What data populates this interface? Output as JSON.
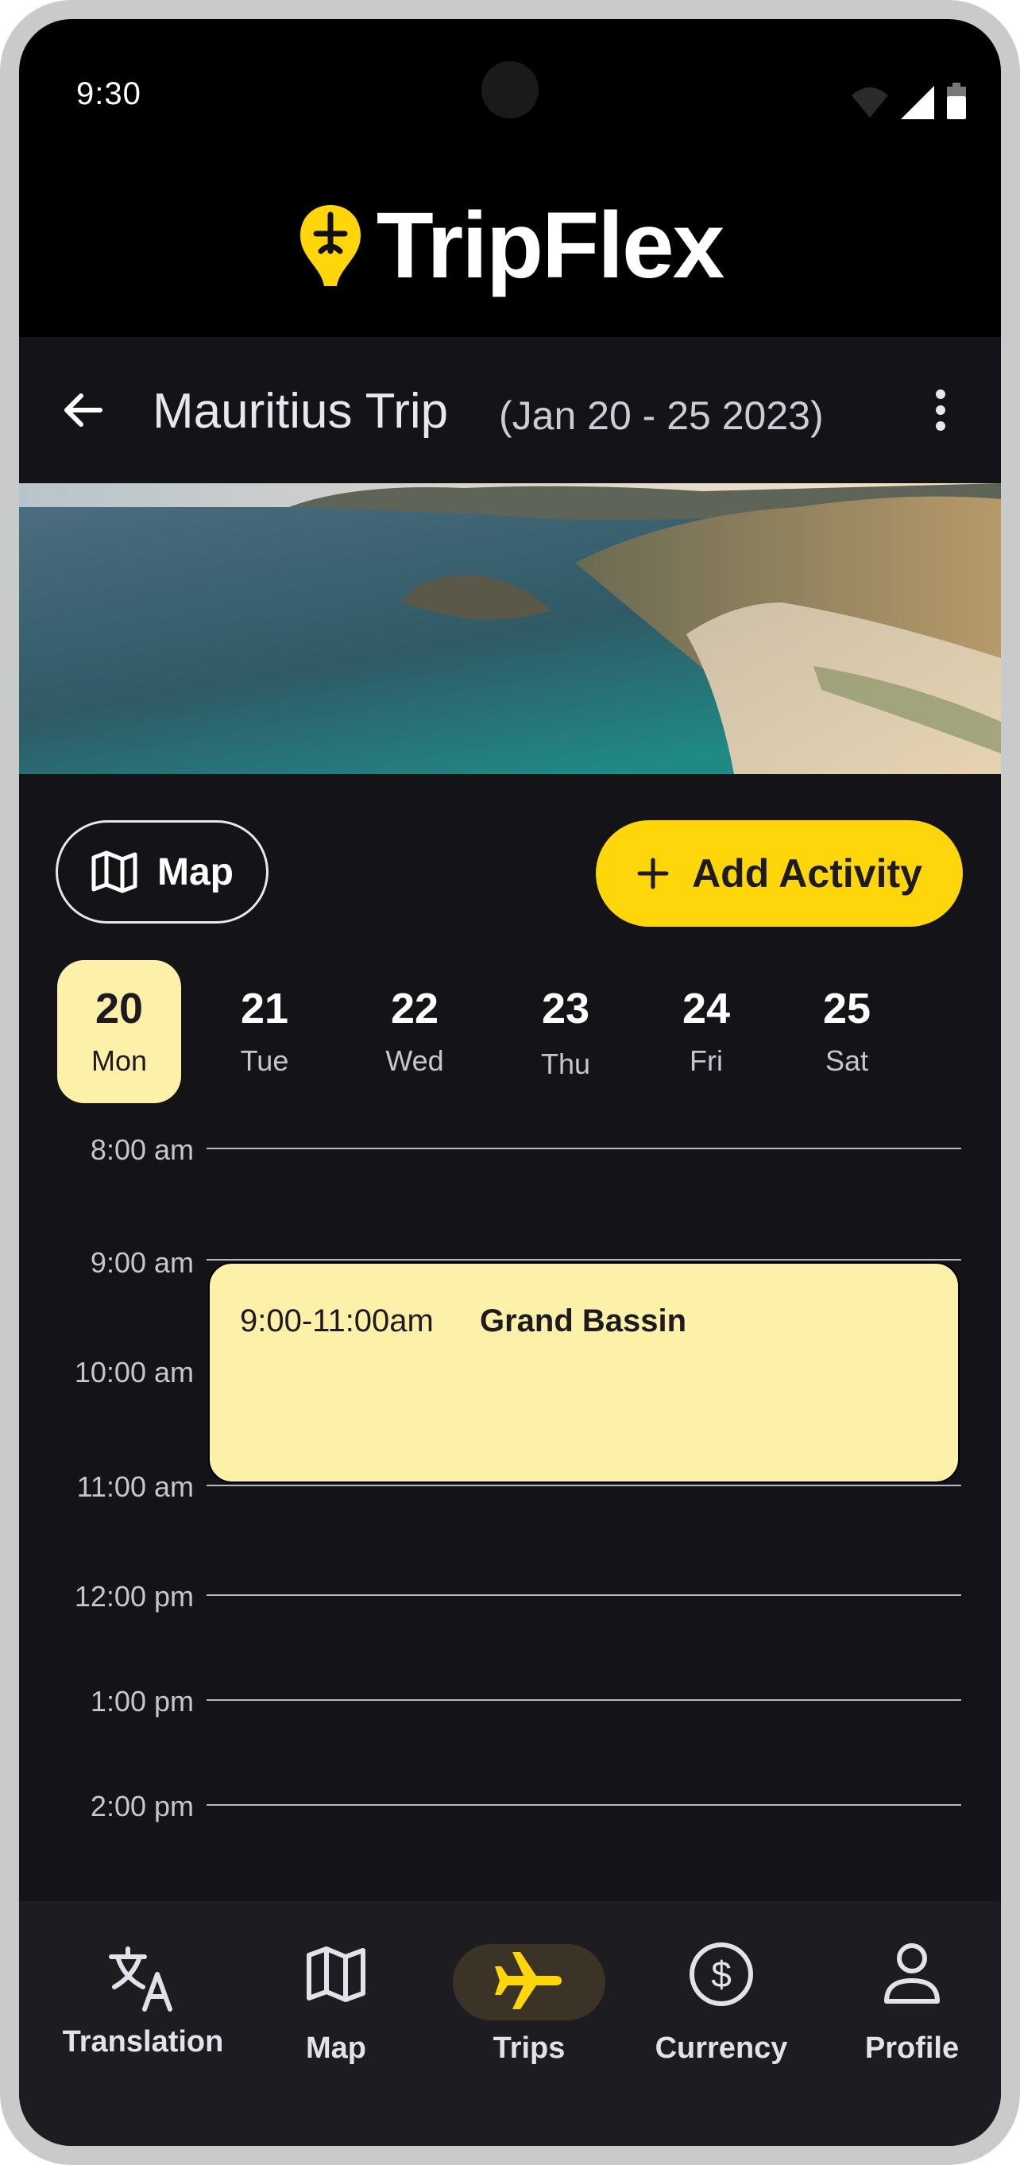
{
  "status_bar": {
    "time": "9:30"
  },
  "brand": {
    "name": "TripFlex"
  },
  "app_bar": {
    "title": "Mauritius Trip",
    "dates": "(Jan 20 - 25 2023)"
  },
  "actions": {
    "map_label": "Map",
    "add_activity_label": "Add Activity"
  },
  "days": [
    {
      "num": "20",
      "name": "Mon",
      "selected": true
    },
    {
      "num": "21",
      "name": "Tue"
    },
    {
      "num": "22",
      "name": "Wed"
    },
    {
      "num": "23",
      "name": "Thu"
    },
    {
      "num": "24",
      "name": "Fri"
    },
    {
      "num": "25",
      "name": "Sat"
    }
  ],
  "schedule": {
    "hours": [
      "8:00 am",
      "9:00 am",
      "10:00 am",
      "11:00 am",
      "12:00 pm",
      "1:00 pm",
      "2:00 pm"
    ],
    "event": {
      "time": "9:00-11:00am",
      "name": "Grand Bassin"
    }
  },
  "nav": [
    {
      "label": "Translation",
      "icon": "translate-icon"
    },
    {
      "label": "Map",
      "icon": "map-icon"
    },
    {
      "label": "Trips",
      "icon": "airplane-icon",
      "active": true
    },
    {
      "label": "Currency",
      "icon": "currency-icon"
    },
    {
      "label": "Profile",
      "icon": "profile-icon"
    }
  ],
  "colors": {
    "accent": "#ffd60a",
    "selected_bg": "#fdf0a8",
    "panel": "#141318"
  }
}
